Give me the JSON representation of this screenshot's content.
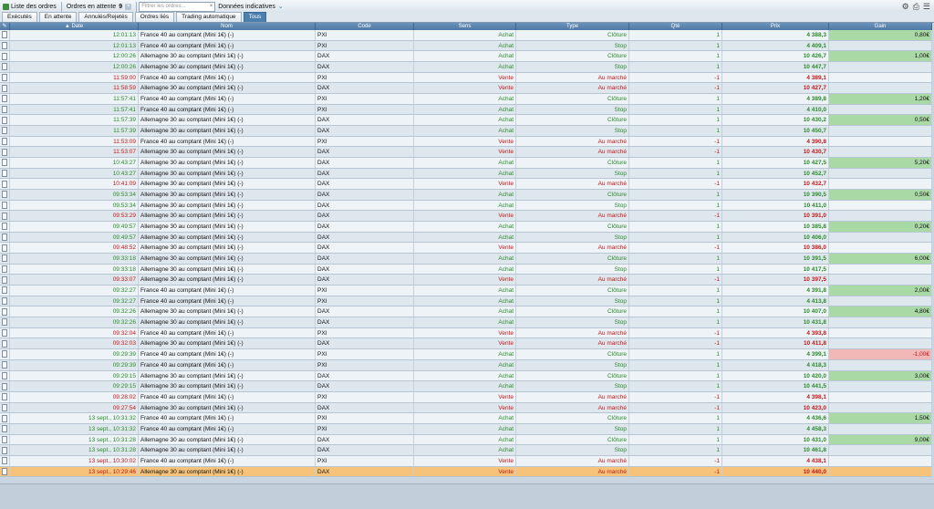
{
  "toolbar": {
    "list_label": "Liste des ordres",
    "pending_label": "Ordres en attente",
    "pending_count": "9",
    "search_placeholder": "Filtrer les ordres...",
    "data_label": "Données indicatives"
  },
  "tabs": [
    "Exécutés",
    "En attente",
    "Annulés/Rejetés",
    "Ordres liés",
    "Trading automatique",
    "Tous"
  ],
  "active_tab": "Tous",
  "columns": [
    "Date",
    "Nom",
    "Code",
    "Sens",
    "Type",
    "Qté",
    "Prix",
    "Gain"
  ],
  "colors": {
    "buy": "#2a8a2a",
    "sell": "#c01818",
    "gain_positive": "#a9d9a5",
    "gain_negative": "#f2b8b8",
    "selected_row": "#f7c37a"
  },
  "rows": [
    {
      "date": "12:01:13",
      "nom": "France 40 au comptant (Mini 1€) (-)",
      "code": "PXI",
      "sens": "Achat",
      "type": "Clôture",
      "qte": "1",
      "prix": "4 388,3",
      "gain": "0,80€"
    },
    {
      "date": "12:01:13",
      "nom": "France 40 au comptant (Mini 1€) (-)",
      "code": "PXI",
      "sens": "Achat",
      "type": "Stop",
      "qte": "1",
      "prix": "4 409,1",
      "gain": ""
    },
    {
      "date": "12:00:26",
      "nom": "Allemagne 30 au comptant (Mini 1€) (-)",
      "code": "DAX",
      "sens": "Achat",
      "type": "Clôture",
      "qte": "1",
      "prix": "10 426,7",
      "gain": "1,00€"
    },
    {
      "date": "12:00:26",
      "nom": "Allemagne 30 au comptant (Mini 1€) (-)",
      "code": "DAX",
      "sens": "Achat",
      "type": "Stop",
      "qte": "1",
      "prix": "10 447,7",
      "gain": ""
    },
    {
      "date": "11:59:00",
      "nom": "France 40 au comptant (Mini 1€) (-)",
      "code": "PXI",
      "sens": "Vente",
      "type": "Au marché",
      "qte": "-1",
      "prix": "4 389,1",
      "gain": ""
    },
    {
      "date": "11:58:59",
      "nom": "Allemagne 30 au comptant (Mini 1€) (-)",
      "code": "DAX",
      "sens": "Vente",
      "type": "Au marché",
      "qte": "-1",
      "prix": "10 427,7",
      "gain": ""
    },
    {
      "date": "11:57:41",
      "nom": "France 40 au comptant (Mini 1€) (-)",
      "code": "PXI",
      "sens": "Achat",
      "type": "Clôture",
      "qte": "1",
      "prix": "4 389,8",
      "gain": "1,20€"
    },
    {
      "date": "11:57:41",
      "nom": "France 40 au comptant (Mini 1€) (-)",
      "code": "PXI",
      "sens": "Achat",
      "type": "Stop",
      "qte": "1",
      "prix": "4 410,0",
      "gain": ""
    },
    {
      "date": "11:57:39",
      "nom": "Allemagne 30 au comptant (Mini 1€) (-)",
      "code": "DAX",
      "sens": "Achat",
      "type": "Clôture",
      "qte": "1",
      "prix": "10 430,2",
      "gain": "0,50€"
    },
    {
      "date": "11:57:39",
      "nom": "Allemagne 30 au comptant (Mini 1€) (-)",
      "code": "DAX",
      "sens": "Achat",
      "type": "Stop",
      "qte": "1",
      "prix": "10 450,7",
      "gain": ""
    },
    {
      "date": "11:53:09",
      "nom": "France 40 au comptant (Mini 1€) (-)",
      "code": "PXI",
      "sens": "Vente",
      "type": "Au marché",
      "qte": "-1",
      "prix": "4 390,8",
      "gain": ""
    },
    {
      "date": "11:53:07",
      "nom": "Allemagne 30 au comptant (Mini 1€) (-)",
      "code": "DAX",
      "sens": "Vente",
      "type": "Au marché",
      "qte": "-1",
      "prix": "10 430,7",
      "gain": ""
    },
    {
      "date": "10:43:27",
      "nom": "Allemagne 30 au comptant (Mini 1€) (-)",
      "code": "DAX",
      "sens": "Achat",
      "type": "Clôture",
      "qte": "1",
      "prix": "10 427,5",
      "gain": "5,20€"
    },
    {
      "date": "10:43:27",
      "nom": "Allemagne 30 au comptant (Mini 1€) (-)",
      "code": "DAX",
      "sens": "Achat",
      "type": "Stop",
      "qte": "1",
      "prix": "10 452,7",
      "gain": ""
    },
    {
      "date": "10:41:09",
      "nom": "Allemagne 30 au comptant (Mini 1€) (-)",
      "code": "DAX",
      "sens": "Vente",
      "type": "Au marché",
      "qte": "-1",
      "prix": "10 432,7",
      "gain": ""
    },
    {
      "date": "09:53:34",
      "nom": "Allemagne 30 au comptant (Mini 1€) (-)",
      "code": "DAX",
      "sens": "Achat",
      "type": "Clôture",
      "qte": "1",
      "prix": "10 390,5",
      "gain": "0,50€"
    },
    {
      "date": "09:53:34",
      "nom": "Allemagne 30 au comptant (Mini 1€) (-)",
      "code": "DAX",
      "sens": "Achat",
      "type": "Stop",
      "qte": "1",
      "prix": "10 411,0",
      "gain": ""
    },
    {
      "date": "09:53:29",
      "nom": "Allemagne 30 au comptant (Mini 1€) (-)",
      "code": "DAX",
      "sens": "Vente",
      "type": "Au marché",
      "qte": "-1",
      "prix": "10 391,0",
      "gain": ""
    },
    {
      "date": "09:49:57",
      "nom": "Allemagne 30 au comptant (Mini 1€) (-)",
      "code": "DAX",
      "sens": "Achat",
      "type": "Clôture",
      "qte": "1",
      "prix": "10 385,8",
      "gain": "0,20€"
    },
    {
      "date": "09:49:57",
      "nom": "Allemagne 30 au comptant (Mini 1€) (-)",
      "code": "DAX",
      "sens": "Achat",
      "type": "Stop",
      "qte": "1",
      "prix": "10 406,0",
      "gain": ""
    },
    {
      "date": "09:48:52",
      "nom": "Allemagne 30 au comptant (Mini 1€) (-)",
      "code": "DAX",
      "sens": "Vente",
      "type": "Au marché",
      "qte": "-1",
      "prix": "10 386,0",
      "gain": ""
    },
    {
      "date": "09:33:18",
      "nom": "Allemagne 30 au comptant (Mini 1€) (-)",
      "code": "DAX",
      "sens": "Achat",
      "type": "Clôture",
      "qte": "1",
      "prix": "10 391,5",
      "gain": "6,00€"
    },
    {
      "date": "09:33:18",
      "nom": "Allemagne 30 au comptant (Mini 1€) (-)",
      "code": "DAX",
      "sens": "Achat",
      "type": "Stop",
      "qte": "1",
      "prix": "10 417,5",
      "gain": ""
    },
    {
      "date": "09:33:07",
      "nom": "Allemagne 30 au comptant (Mini 1€) (-)",
      "code": "DAX",
      "sens": "Vente",
      "type": "Au marché",
      "qte": "-1",
      "prix": "10 397,5",
      "gain": ""
    },
    {
      "date": "09:32:27",
      "nom": "France 40 au comptant (Mini 1€) (-)",
      "code": "PXI",
      "sens": "Achat",
      "type": "Clôture",
      "qte": "1",
      "prix": "4 391,8",
      "gain": "2,00€"
    },
    {
      "date": "09:32:27",
      "nom": "France 40 au comptant (Mini 1€) (-)",
      "code": "PXI",
      "sens": "Achat",
      "type": "Stop",
      "qte": "1",
      "prix": "4 413,8",
      "gain": ""
    },
    {
      "date": "09:32:26",
      "nom": "Allemagne 30 au comptant (Mini 1€) (-)",
      "code": "DAX",
      "sens": "Achat",
      "type": "Clôture",
      "qte": "1",
      "prix": "10 407,0",
      "gain": "4,80€"
    },
    {
      "date": "09:32:26",
      "nom": "Allemagne 30 au comptant (Mini 1€) (-)",
      "code": "DAX",
      "sens": "Achat",
      "type": "Stop",
      "qte": "1",
      "prix": "10 431,8",
      "gain": ""
    },
    {
      "date": "09:32:04",
      "nom": "France 40 au comptant (Mini 1€) (-)",
      "code": "PXI",
      "sens": "Vente",
      "type": "Au marché",
      "qte": "-1",
      "prix": "4 393,8",
      "gain": ""
    },
    {
      "date": "09:32:03",
      "nom": "Allemagne 30 au comptant (Mini 1€) (-)",
      "code": "DAX",
      "sens": "Vente",
      "type": "Au marché",
      "qte": "-1",
      "prix": "10 411,8",
      "gain": ""
    },
    {
      "date": "09:29:39",
      "nom": "France 40 au comptant (Mini 1€) (-)",
      "code": "PXI",
      "sens": "Achat",
      "type": "Clôture",
      "qte": "1",
      "prix": "4 399,1",
      "gain": "-1,00€"
    },
    {
      "date": "09:29:39",
      "nom": "France 40 au comptant (Mini 1€) (-)",
      "code": "PXI",
      "sens": "Achat",
      "type": "Stop",
      "qte": "1",
      "prix": "4 418,3",
      "gain": ""
    },
    {
      "date": "09:29:15",
      "nom": "Allemagne 30 au comptant (Mini 1€) (-)",
      "code": "DAX",
      "sens": "Achat",
      "type": "Clôture",
      "qte": "1",
      "prix": "10 420,0",
      "gain": "3,00€"
    },
    {
      "date": "09:29:15",
      "nom": "Allemagne 30 au comptant (Mini 1€) (-)",
      "code": "DAX",
      "sens": "Achat",
      "type": "Stop",
      "qte": "1",
      "prix": "10 441,5",
      "gain": ""
    },
    {
      "date": "09:28:02",
      "nom": "France 40 au comptant (Mini 1€) (-)",
      "code": "PXI",
      "sens": "Vente",
      "type": "Au marché",
      "qte": "-1",
      "prix": "4 398,1",
      "gain": ""
    },
    {
      "date": "09:27:54",
      "nom": "Allemagne 30 au comptant (Mini 1€) (-)",
      "code": "DAX",
      "sens": "Vente",
      "type": "Au marché",
      "qte": "-1",
      "prix": "10 423,0",
      "gain": ""
    },
    {
      "date": "13 sept., 10:31:32",
      "nom": "France 40 au comptant (Mini 1€) (-)",
      "code": "PXI",
      "sens": "Achat",
      "type": "Clôture",
      "qte": "1",
      "prix": "4 436,6",
      "gain": "1,50€"
    },
    {
      "date": "13 sept., 10:31:32",
      "nom": "France 40 au comptant (Mini 1€) (-)",
      "code": "PXI",
      "sens": "Achat",
      "type": "Stop",
      "qte": "1",
      "prix": "4 458,3",
      "gain": ""
    },
    {
      "date": "13 sept., 10:31:28",
      "nom": "Allemagne 30 au comptant (Mini 1€) (-)",
      "code": "DAX",
      "sens": "Achat",
      "type": "Clôture",
      "qte": "1",
      "prix": "10 431,0",
      "gain": "9,00€"
    },
    {
      "date": "13 sept., 10:31:28",
      "nom": "Allemagne 30 au comptant (Mini 1€) (-)",
      "code": "DAX",
      "sens": "Achat",
      "type": "Stop",
      "qte": "1",
      "prix": "10 461,8",
      "gain": ""
    },
    {
      "date": "13 sept., 10:30:02",
      "nom": "France 40 au comptant (Mini 1€) (-)",
      "code": "PXI",
      "sens": "Vente",
      "type": "Au marché",
      "qte": "-1",
      "prix": "4 438,1",
      "gain": ""
    },
    {
      "date": "13 sept., 10:29:46",
      "nom": "Allemagne 30 au comptant (Mini 1€) (-)",
      "code": "DAX",
      "sens": "Vente",
      "type": "Au marché",
      "qte": "-1",
      "prix": "10 440,0",
      "gain": "",
      "selected": true
    }
  ]
}
